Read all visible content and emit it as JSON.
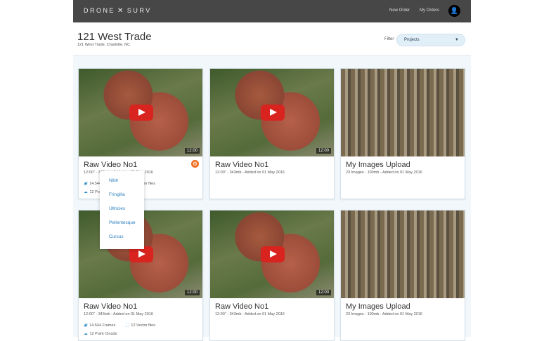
{
  "header": {
    "logo": "DRONE SURV",
    "logo_left": "DRONE",
    "logo_right": "SURV",
    "nav": [
      "New Order",
      "My Orders"
    ]
  },
  "page": {
    "title": "121 West Trade",
    "subtitle": "121 West Trade, Charlotte, NC",
    "filter_label": "Filter",
    "filter_value": "Projects"
  },
  "cards": [
    {
      "title": "Raw Video No1",
      "meta": "12:00\" - 343mb - Added on 01 May 2016",
      "duration": "12:00",
      "frames": "14.544 Frames",
      "vectors": "12 Vector files",
      "clouds": "12 Point Clouds"
    },
    {
      "title": "Raw Video No1",
      "meta": "12:00\" - 343mb - Added on 01 May 2016",
      "duration": "12:00"
    },
    {
      "title": "My Images Upload",
      "meta": "23 Images - 100mb - Added on 01 May 2016"
    },
    {
      "title": "Raw Video No1",
      "meta": "12:00\" - 343mb - Added on 01 May 2016",
      "duration": "12:00",
      "frames": "14.544 Frames",
      "vectors": "12 Vector files",
      "clouds": "12 Point Clouds"
    },
    {
      "title": "Raw Video No1",
      "meta": "12:00\" - 343mb - Added on 01 May 2016",
      "duration": "12:00"
    },
    {
      "title": "My Images Upload",
      "meta": "23 Images - 100mb - Added on 01 May 2016"
    }
  ],
  "menu": [
    "Nibh",
    "Fringilla",
    "Ultricies",
    "Pellentesque",
    "Cursus"
  ]
}
